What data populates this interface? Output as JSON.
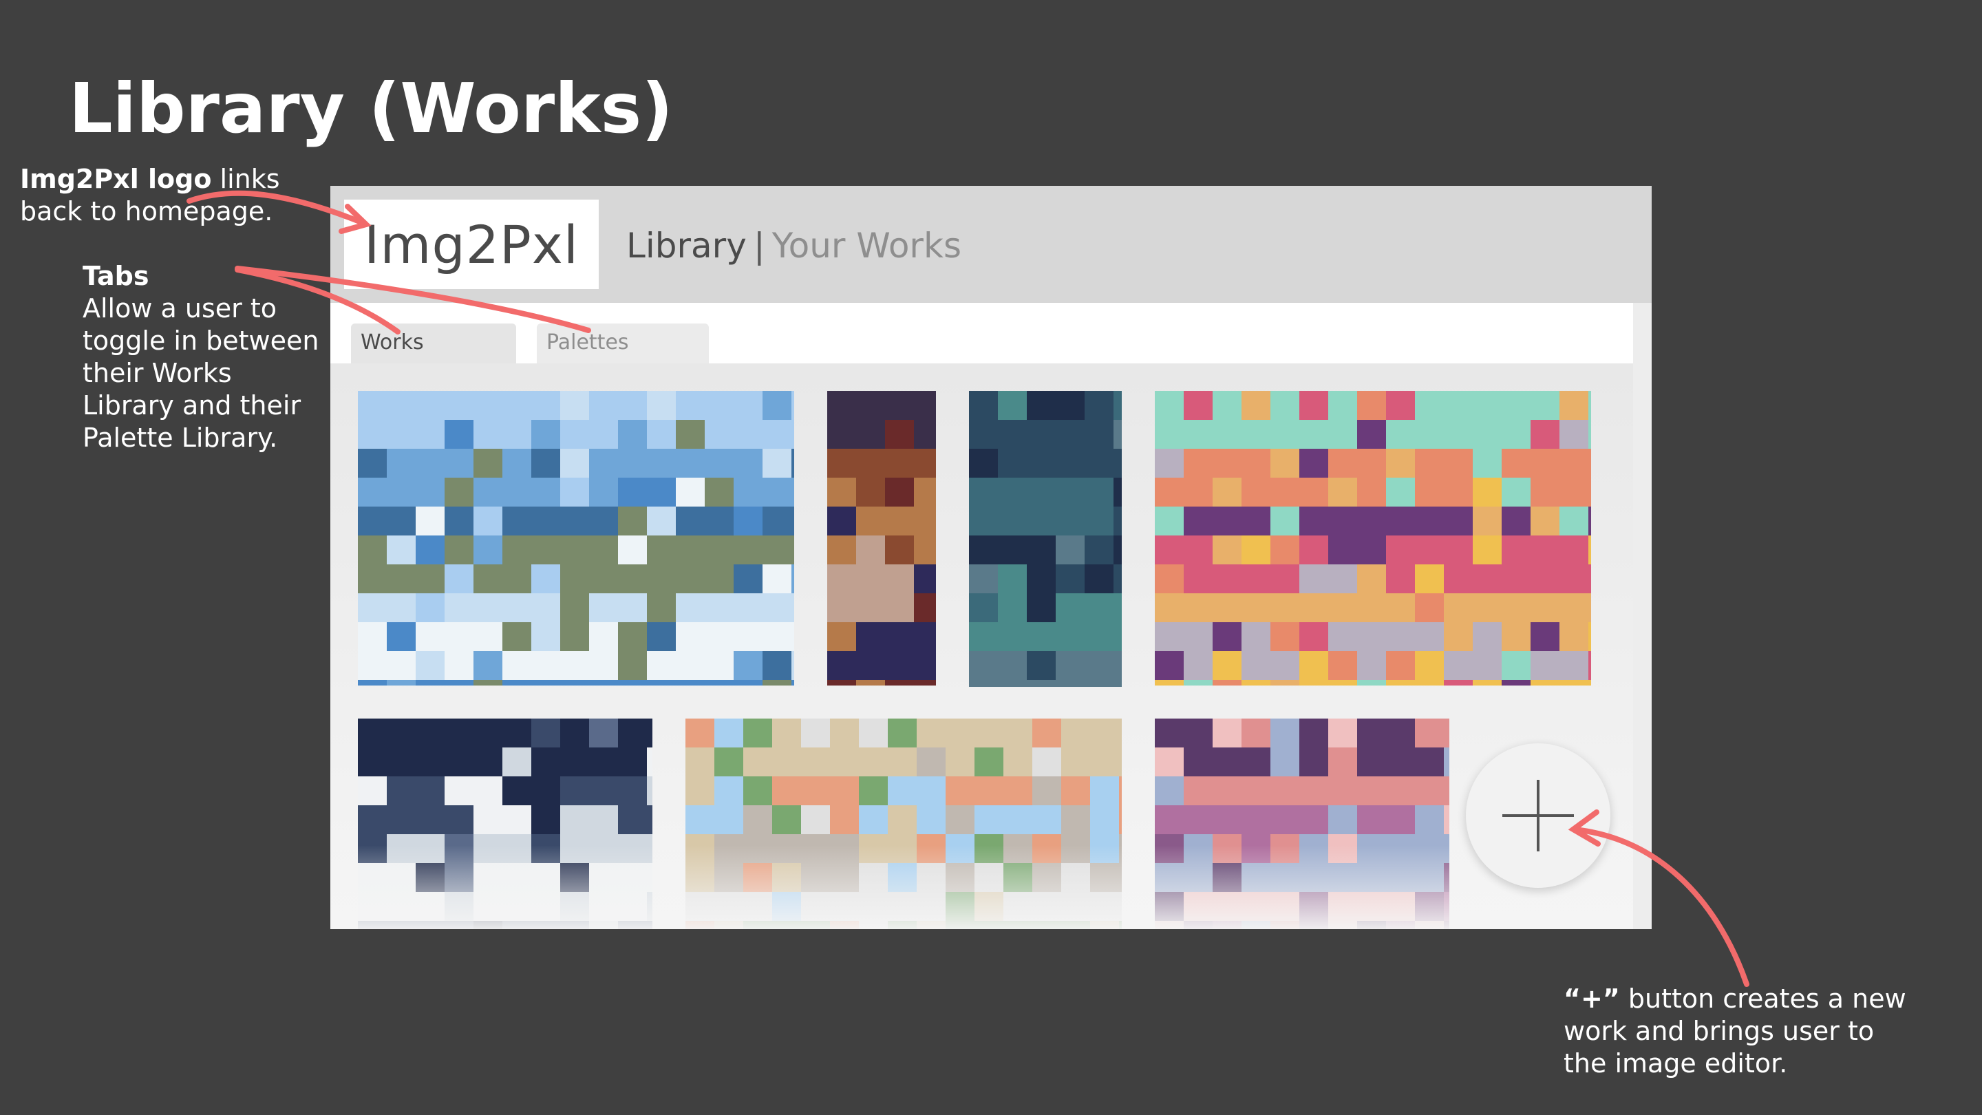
{
  "slide": {
    "title": "Library (Works)"
  },
  "annotations": {
    "logo": {
      "bold": "Img2Pxl logo",
      "text1": " links",
      "text2": "back to homepage."
    },
    "tabs": {
      "heading": "Tabs",
      "lines": [
        "Allow a user to",
        "toggle in between",
        "their Works",
        "Library and their",
        "Palette Library."
      ]
    },
    "plus": {
      "bold": "“+”",
      "line1": " button creates a new",
      "line2": "work and brings user to",
      "line3": "the image editor."
    }
  },
  "app": {
    "logo": "Img2Pxl",
    "breadcrumb": {
      "section": "Library",
      "separator": "|",
      "current": "Your Works"
    },
    "tabs": [
      {
        "label": "Works",
        "active": true
      },
      {
        "label": "Palettes",
        "active": false
      }
    ],
    "add_button_icon": "plus-icon",
    "accent_annotation_color": "#f26b6b",
    "works": [
      {
        "name": "pixel-work-sky",
        "palette": [
          "#a9cdf0",
          "#6fa6d8",
          "#3d6f9e",
          "#7a8a6a",
          "#c7def2",
          "#eef4f8",
          "#4b89c8"
        ]
      },
      {
        "name": "pixel-work-portrait",
        "palette": [
          "#3a2f4a",
          "#8a4a30",
          "#b57a4a",
          "#c0a090",
          "#2e2a5a",
          "#6a2a2a"
        ]
      },
      {
        "name": "pixel-work-teal",
        "palette": [
          "#2c4a62",
          "#3b6a7a",
          "#1f2e4a",
          "#4a8a8a",
          "#5a7a8a"
        ]
      },
      {
        "name": "pixel-work-sunset",
        "palette": [
          "#8fd8c4",
          "#e88a6a",
          "#6a3a7a",
          "#d85a7a",
          "#e8b06a",
          "#b8b0c0",
          "#f0c050"
        ]
      },
      {
        "name": "pixel-work-night",
        "palette": [
          "#1f2a4a",
          "#3a4a6a",
          "#d0d8e0",
          "#f0f2f4",
          "#5a6a8a"
        ]
      },
      {
        "name": "pixel-work-beach",
        "palette": [
          "#d8c8a8",
          "#e8a080",
          "#a8d0f0",
          "#c0b8b0",
          "#e0e0e0",
          "#7aa870"
        ]
      },
      {
        "name": "pixel-work-blossom",
        "palette": [
          "#5a3a6a",
          "#e09090",
          "#b070a0",
          "#a0b0d0",
          "#f0c0c0",
          "#8a5a8a"
        ]
      }
    ]
  }
}
